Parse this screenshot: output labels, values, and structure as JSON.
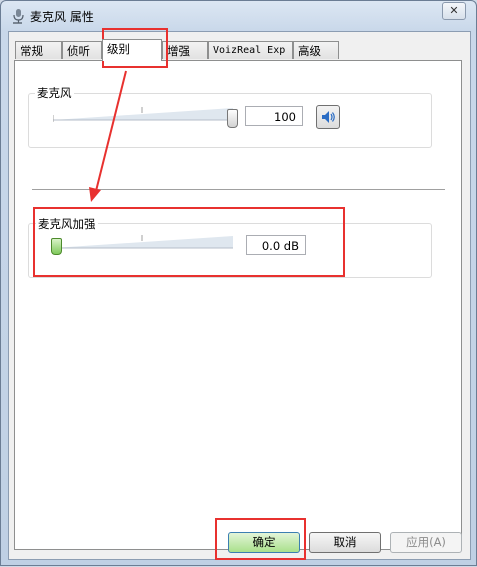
{
  "window": {
    "title": "麦克风 属性",
    "close_glyph": "✕"
  },
  "tabs": [
    {
      "label": "常规"
    },
    {
      "label": "侦听"
    },
    {
      "label": "级别"
    },
    {
      "label": "增强"
    },
    {
      "label": "VoizReal Exp"
    },
    {
      "label": "高级"
    }
  ],
  "active_tab": "级别",
  "levels": {
    "microphone": {
      "label": "麦克风",
      "value": "100",
      "level_fraction": 1.0,
      "speaker_icon": "speaker-icon"
    },
    "boost": {
      "label": "麦克风加强",
      "value": "0.0 dB",
      "level_fraction": 0.0
    }
  },
  "buttons": {
    "ok": "确定",
    "cancel": "取消",
    "apply": "应用(A)"
  },
  "colors": {
    "annotation": "#e8312f",
    "boost_thumb": "#7fc95b"
  }
}
